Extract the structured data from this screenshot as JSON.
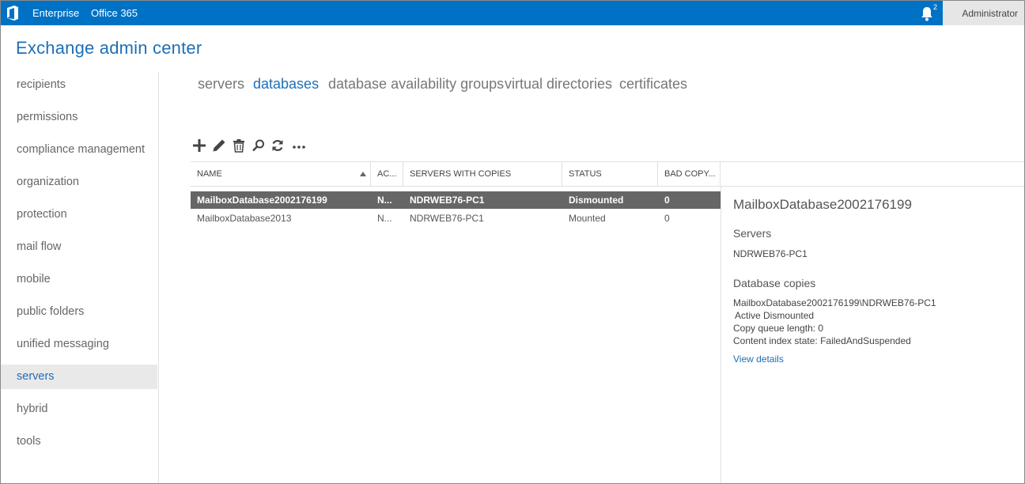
{
  "topbar": {
    "links": [
      "Enterprise",
      "Office 365"
    ],
    "notification_count": "2",
    "user": "Administrator",
    "accent": "#0072c6"
  },
  "app_title": "Exchange admin center",
  "sidebar": {
    "items": [
      {
        "label": "recipients"
      },
      {
        "label": "permissions"
      },
      {
        "label": "compliance management"
      },
      {
        "label": "organization"
      },
      {
        "label": "protection"
      },
      {
        "label": "mail flow"
      },
      {
        "label": "mobile"
      },
      {
        "label": "public folders"
      },
      {
        "label": "unified messaging"
      },
      {
        "label": "servers",
        "active": true
      },
      {
        "label": "hybrid"
      },
      {
        "label": "tools"
      }
    ]
  },
  "tabs": [
    {
      "label": "servers"
    },
    {
      "label": "databases",
      "active": true
    },
    {
      "label": "database availability groups"
    },
    {
      "label": "virtual directories"
    },
    {
      "label": "certificates"
    }
  ],
  "toolbar": {
    "icons": [
      "add-icon",
      "edit-icon",
      "delete-icon",
      "search-icon",
      "refresh-icon",
      "more-icon"
    ],
    "more_label": "..."
  },
  "grid": {
    "columns": [
      "NAME",
      "AC...",
      "SERVERS WITH COPIES",
      "STATUS",
      "BAD COPY..."
    ],
    "rows": [
      {
        "name": "MailboxDatabase2002176199",
        "active": "N...",
        "servers": "NDRWEB76-PC1",
        "status": "Dismounted",
        "bad_copy": "0",
        "selected": true
      },
      {
        "name": "MailboxDatabase2013",
        "active": "N...",
        "servers": "NDRWEB76-PC1",
        "status": "Mounted",
        "bad_copy": "0",
        "selected": false
      }
    ]
  },
  "details": {
    "title": "MailboxDatabase2002176199",
    "servers_heading": "Servers",
    "server": "NDRWEB76-PC1",
    "copies_heading": "Database copies",
    "copy_name": "MailboxDatabase2002176199\\NDRWEB76-PC1",
    "copy_status": "Active Dismounted",
    "copy_queue": "Copy queue length: 0",
    "content_index": "Content index state: FailedAndSuspended",
    "view_details": "View details"
  }
}
